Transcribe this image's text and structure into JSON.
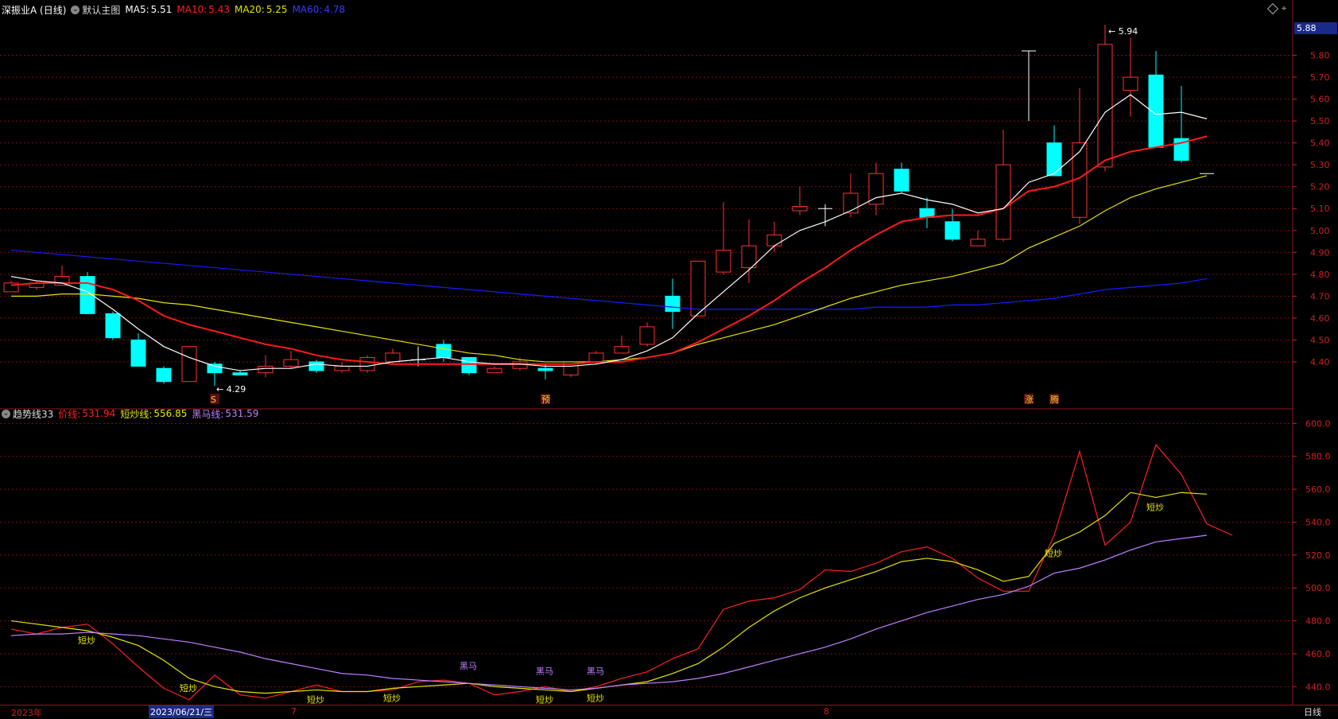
{
  "main_header": {
    "stock": "深振业A (日线)",
    "chart_mode": "默认主图",
    "ma5_label": "MA5:",
    "ma5": "5.51",
    "ma10_label": "MA10:",
    "ma10": "5.43",
    "ma20_label": "MA20:",
    "ma20": "5.25",
    "ma60_label": "MA60:",
    "ma60": "4.78"
  },
  "sub_header": {
    "indicator": "趋势线33",
    "price_label": "价线:",
    "price": "531.94",
    "short_label": "短炒线:",
    "short": "556.85",
    "dark_label": "黑马线:",
    "dark": "531.59"
  },
  "price_badge": "5.88",
  "max_label": "5.94",
  "min_label": "4.29",
  "bottom_axis": {
    "year": "2023年",
    "cursor_date": "2023/06/21/三",
    "m7": "7",
    "m8": "8",
    "period": "日线"
  },
  "colors": {
    "bg": "#000000",
    "up": "#ff3232",
    "down": "#00ffff",
    "ma5": "#ffffff",
    "ma10": "#ff1a1a",
    "ma20": "#e5e500",
    "ma60": "#1a1aff",
    "grid": "#7a1010",
    "short": "#e5e500",
    "dark": "#c080ff"
  },
  "chart_data": [
    {
      "type": "candlestick",
      "title": "深振业A (日线)",
      "ylim": [
        4.2,
        5.98
      ],
      "yticks": [
        "5.80",
        "5.70",
        "5.60",
        "5.50",
        "5.40",
        "5.30",
        "5.20",
        "5.10",
        "5.00",
        "4.90",
        "4.80",
        "4.70",
        "4.60",
        "4.50",
        "4.40"
      ],
      "candles": [
        {
          "o": 4.72,
          "c": 4.76,
          "h": 4.77,
          "l": 4.72
        },
        {
          "o": 4.74,
          "c": 4.76,
          "h": 4.77,
          "l": 4.73
        },
        {
          "o": 4.75,
          "c": 4.79,
          "h": 4.84,
          "l": 4.75
        },
        {
          "o": 4.79,
          "c": 4.62,
          "h": 4.81,
          "l": 4.62
        },
        {
          "o": 4.62,
          "c": 4.51,
          "h": 4.63,
          "l": 4.5
        },
        {
          "o": 4.5,
          "c": 4.38,
          "h": 4.53,
          "l": 4.38
        },
        {
          "o": 4.37,
          "c": 4.31,
          "h": 4.38,
          "l": 4.3
        },
        {
          "o": 4.31,
          "c": 4.47,
          "h": 4.47,
          "l": 4.31
        },
        {
          "o": 4.39,
          "c": 4.35,
          "h": 4.4,
          "l": 4.29
        },
        {
          "o": 4.35,
          "c": 4.34,
          "h": 4.36,
          "l": 4.34
        },
        {
          "o": 4.35,
          "c": 4.38,
          "h": 4.43,
          "l": 4.33
        },
        {
          "o": 4.38,
          "c": 4.41,
          "h": 4.45,
          "l": 4.37
        },
        {
          "o": 4.4,
          "c": 4.36,
          "h": 4.41,
          "l": 4.35
        },
        {
          "o": 4.36,
          "c": 4.38,
          "h": 4.4,
          "l": 4.35
        },
        {
          "o": 4.36,
          "c": 4.42,
          "h": 4.43,
          "l": 4.35
        },
        {
          "o": 4.4,
          "c": 4.44,
          "h": 4.46,
          "l": 4.39
        },
        {
          "o": 4.41,
          "c": 4.41,
          "h": 4.47,
          "l": 4.38
        },
        {
          "o": 4.48,
          "c": 4.42,
          "h": 4.5,
          "l": 4.4
        },
        {
          "o": 4.42,
          "c": 4.35,
          "h": 4.42,
          "l": 4.34
        },
        {
          "o": 4.35,
          "c": 4.37,
          "h": 4.38,
          "l": 4.35
        },
        {
          "o": 4.37,
          "c": 4.4,
          "h": 4.42,
          "l": 4.36
        },
        {
          "o": 4.37,
          "c": 4.36,
          "h": 4.39,
          "l": 4.32
        },
        {
          "o": 4.34,
          "c": 4.4,
          "h": 4.4,
          "l": 4.33
        },
        {
          "o": 4.4,
          "c": 4.44,
          "h": 4.45,
          "l": 4.39
        },
        {
          "o": 4.44,
          "c": 4.47,
          "h": 4.52,
          "l": 4.44
        },
        {
          "o": 4.48,
          "c": 4.56,
          "h": 4.58,
          "l": 4.47
        },
        {
          "o": 4.7,
          "c": 4.63,
          "h": 4.78,
          "l": 4.55
        },
        {
          "o": 4.61,
          "c": 4.86,
          "h": 4.86,
          "l": 4.61
        },
        {
          "o": 4.81,
          "c": 4.91,
          "h": 5.13,
          "l": 4.8
        },
        {
          "o": 4.83,
          "c": 4.93,
          "h": 5.05,
          "l": 4.76
        },
        {
          "o": 4.93,
          "c": 4.98,
          "h": 5.04,
          "l": 4.9
        },
        {
          "o": 5.09,
          "c": 5.11,
          "h": 5.2,
          "l": 5.07
        },
        {
          "o": 5.1,
          "c": 5.1,
          "h": 5.12,
          "l": 5.02
        },
        {
          "o": 5.08,
          "c": 5.17,
          "h": 5.26,
          "l": 5.06
        },
        {
          "o": 5.12,
          "c": 5.26,
          "h": 5.31,
          "l": 5.07
        },
        {
          "o": 5.28,
          "c": 5.18,
          "h": 5.31,
          "l": 5.17
        },
        {
          "o": 5.1,
          "c": 5.06,
          "h": 5.15,
          "l": 5.01
        },
        {
          "o": 5.04,
          "c": 4.96,
          "h": 5.1,
          "l": 4.95
        },
        {
          "o": 4.93,
          "c": 4.96,
          "h": 5.0,
          "l": 4.93
        },
        {
          "o": 4.96,
          "c": 5.3,
          "h": 5.46,
          "l": 4.95
        },
        {
          "o": 5.82,
          "c": 5.82,
          "h": 5.82,
          "l": 5.5
        },
        {
          "o": 5.4,
          "c": 5.25,
          "h": 5.48,
          "l": 5.25
        },
        {
          "o": 5.06,
          "c": 5.4,
          "h": 5.65,
          "l": 5.03
        },
        {
          "o": 5.29,
          "c": 5.85,
          "h": 5.94,
          "l": 5.27
        },
        {
          "o": 5.64,
          "c": 5.7,
          "h": 5.88,
          "l": 5.52
        },
        {
          "o": 5.71,
          "c": 5.38,
          "h": 5.82,
          "l": 5.38
        },
        {
          "o": 5.42,
          "c": 5.32,
          "h": 5.66,
          "l": 5.31
        },
        {
          "o": 5.26,
          "c": 5.26,
          "h": 5.26,
          "l": 5.26
        }
      ],
      "ma5": [
        4.79,
        4.77,
        4.76,
        4.72,
        4.64,
        4.55,
        4.47,
        4.42,
        4.38,
        4.36,
        4.37,
        4.37,
        4.39,
        4.38,
        4.38,
        4.4,
        4.41,
        4.42,
        4.4,
        4.39,
        4.39,
        4.38,
        4.38,
        4.39,
        4.41,
        4.45,
        4.51,
        4.62,
        4.72,
        4.82,
        4.93,
        5.0,
        5.04,
        5.09,
        5.15,
        5.17,
        5.14,
        5.12,
        5.08,
        5.1,
        5.22,
        5.26,
        5.36,
        5.54,
        5.62,
        5.53,
        5.54,
        5.51
      ],
      "ma10": [
        4.75,
        4.76,
        4.76,
        4.76,
        4.73,
        4.68,
        4.61,
        4.57,
        4.54,
        4.51,
        4.48,
        4.46,
        4.43,
        4.41,
        4.4,
        4.39,
        4.39,
        4.39,
        4.39,
        4.39,
        4.39,
        4.39,
        4.39,
        4.4,
        4.4,
        4.42,
        4.44,
        4.49,
        4.55,
        4.61,
        4.68,
        4.76,
        4.83,
        4.91,
        4.98,
        5.04,
        5.06,
        5.07,
        5.07,
        5.1,
        5.18,
        5.2,
        5.24,
        5.32,
        5.36,
        5.38,
        5.4,
        5.43
      ],
      "ma20": [
        4.7,
        4.7,
        4.71,
        4.71,
        4.7,
        4.69,
        4.67,
        4.66,
        4.64,
        4.62,
        4.6,
        4.58,
        4.56,
        4.54,
        4.52,
        4.5,
        4.48,
        4.46,
        4.44,
        4.43,
        4.41,
        4.4,
        4.4,
        4.4,
        4.41,
        4.42,
        4.44,
        4.48,
        4.51,
        4.54,
        4.57,
        4.61,
        4.65,
        4.69,
        4.72,
        4.75,
        4.77,
        4.79,
        4.82,
        4.85,
        4.92,
        4.97,
        5.02,
        5.09,
        5.15,
        5.19,
        5.22,
        5.25
      ],
      "ma60": [
        4.91,
        4.9,
        4.89,
        4.88,
        4.87,
        4.86,
        4.85,
        4.84,
        4.83,
        4.82,
        4.81,
        4.8,
        4.79,
        4.78,
        4.77,
        4.76,
        4.75,
        4.74,
        4.73,
        4.72,
        4.71,
        4.7,
        4.69,
        4.68,
        4.67,
        4.66,
        4.65,
        4.64,
        4.64,
        4.64,
        4.64,
        4.64,
        4.64,
        4.64,
        4.65,
        4.65,
        4.65,
        4.66,
        4.66,
        4.67,
        4.68,
        4.69,
        4.71,
        4.73,
        4.74,
        4.75,
        4.76,
        4.78
      ],
      "markers": [
        {
          "index": 8,
          "text": "S"
        },
        {
          "index": 21,
          "text": "预"
        },
        {
          "index": 40,
          "text": "涨"
        },
        {
          "index": 41,
          "text": "腾"
        }
      ]
    },
    {
      "type": "line",
      "title": "趋势线33",
      "ylim": [
        430,
        605
      ],
      "yticks": [
        "600.0",
        "580.0",
        "560.0",
        "540.0",
        "520.0",
        "500.0",
        "480.0",
        "460.0",
        "440.0"
      ],
      "series": [
        {
          "name": "价线",
          "values": [
            475,
            472,
            476,
            478,
            466,
            452,
            439,
            432,
            447,
            435,
            433,
            437,
            441,
            437,
            437,
            438,
            443,
            444,
            442,
            435,
            437,
            440,
            437,
            440,
            445,
            449,
            457,
            463,
            487,
            492,
            494,
            499,
            511,
            510,
            515,
            522,
            525,
            518,
            506,
            498,
            498,
            532,
            583,
            526,
            540,
            587,
            569,
            539,
            532
          ]
        },
        {
          "name": "短炒线",
          "values": [
            480,
            478,
            476,
            474,
            470,
            465,
            456,
            445,
            440,
            437,
            436,
            437,
            438,
            437,
            437,
            439,
            440,
            441,
            442,
            440,
            439,
            438,
            437,
            439,
            441,
            443,
            448,
            454,
            464,
            476,
            486,
            494,
            500,
            505,
            510,
            516,
            518,
            516,
            511,
            504,
            507,
            527,
            534,
            544,
            558,
            555,
            558,
            557
          ]
        },
        {
          "name": "黑马线",
          "values": [
            471,
            472,
            472,
            473,
            472,
            471,
            469,
            467,
            464,
            461,
            457,
            454,
            451,
            448,
            447,
            445,
            444,
            443,
            442,
            441,
            440,
            439,
            438,
            439,
            441,
            442,
            443,
            445,
            448,
            452,
            456,
            460,
            464,
            469,
            475,
            480,
            485,
            489,
            493,
            496,
            501,
            509,
            512,
            517,
            523,
            528,
            530,
            532
          ]
        }
      ],
      "annotations": [
        {
          "index": 3,
          "text": "短炒",
          "series": "短炒线"
        },
        {
          "index": 7,
          "text": "短炒",
          "series": "短炒线"
        },
        {
          "index": 12,
          "text": "短炒",
          "series": "短炒线"
        },
        {
          "index": 15,
          "text": "短炒",
          "series": "短炒线"
        },
        {
          "index": 21,
          "text": "短炒",
          "series": "短炒线"
        },
        {
          "index": 23,
          "text": "短炒",
          "series": "短炒线"
        },
        {
          "index": 41,
          "text": "短炒",
          "series": "短炒线"
        },
        {
          "index": 45,
          "text": "短炒",
          "series": "短炒线"
        },
        {
          "index": 18,
          "text": "黑马",
          "series": "黑马线"
        },
        {
          "index": 21,
          "text": "黑马",
          "series": "黑马线"
        },
        {
          "index": 23,
          "text": "黑马",
          "series": "黑马线"
        }
      ]
    }
  ]
}
